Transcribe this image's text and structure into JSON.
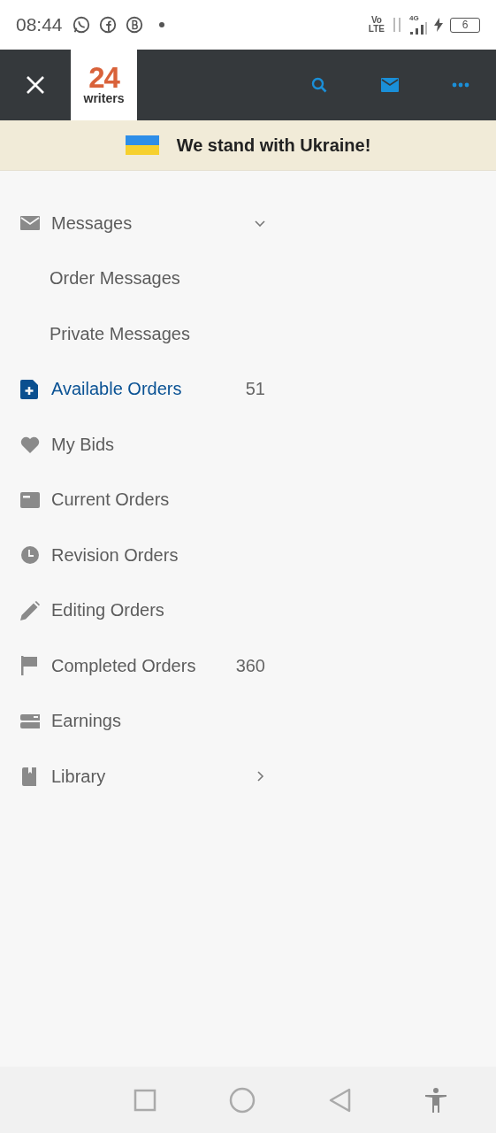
{
  "status_bar": {
    "time": "08:44",
    "network": "Vo\nLTE",
    "network_type": "4G",
    "battery": "6"
  },
  "header": {
    "logo_number": "24",
    "logo_word": "writers"
  },
  "banner": {
    "text": "We stand with Ukraine!"
  },
  "menu": [
    {
      "label": "Messages",
      "selected": false,
      "expanded": true,
      "children": [
        {
          "label": "Order Messages",
          "selected": false
        },
        {
          "label": "Private Messages",
          "selected": false
        }
      ]
    },
    {
      "label": "Available Orders",
      "selected": true,
      "count": "51"
    },
    {
      "label": "My Bids",
      "selected": false
    },
    {
      "label": "Current Orders",
      "selected": false
    },
    {
      "label": "Revision Orders",
      "selected": false
    },
    {
      "label": "Editing Orders",
      "selected": false
    },
    {
      "label": "Completed Orders",
      "selected": false,
      "count": "360"
    },
    {
      "label": "Earnings",
      "selected": false
    },
    {
      "label": "Library",
      "selected": false,
      "expanded": false
    }
  ]
}
